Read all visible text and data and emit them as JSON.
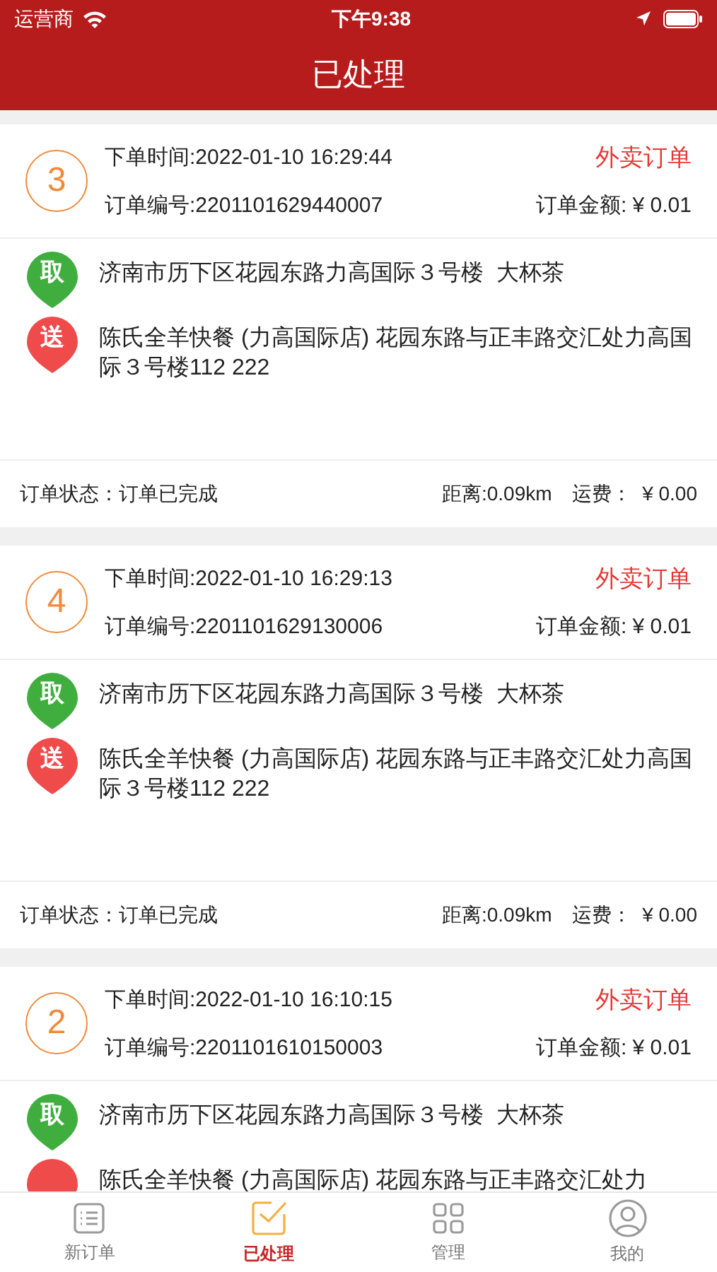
{
  "status_bar": {
    "carrier": "运营商",
    "time": "下午9:38"
  },
  "header": {
    "title": "已处理"
  },
  "orders": [
    {
      "number": "3",
      "time": "下单时间:2022-01-10 16:29:44",
      "type": "外卖订单",
      "order_no": "订单编号:2201101629440007",
      "amount": "订单金额: ¥ 0.01",
      "stops": [
        {
          "kind": "pickup",
          "label": "取",
          "address": "济南市历下区花园东路力高国际３号楼  大杯茶"
        },
        {
          "kind": "delivery",
          "label": "送",
          "address": "陈氏全羊快餐 (力高国际店) 花园东路与正丰路交汇处力高国际３号楼112 222"
        }
      ],
      "status": "订单状态：订单已完成",
      "distance": "距离:0.09km",
      "fee": "运费：  ¥ 0.00"
    },
    {
      "number": "4",
      "time": "下单时间:2022-01-10 16:29:13",
      "type": "外卖订单",
      "order_no": "订单编号:2201101629130006",
      "amount": "订单金额: ¥ 0.01",
      "stops": [
        {
          "kind": "pickup",
          "label": "取",
          "address": "济南市历下区花园东路力高国际３号楼  大杯茶"
        },
        {
          "kind": "delivery",
          "label": "送",
          "address": "陈氏全羊快餐 (力高国际店) 花园东路与正丰路交汇处力高国际３号楼112 222"
        }
      ],
      "status": "订单状态：订单已完成",
      "distance": "距离:0.09km",
      "fee": "运费：  ¥ 0.00"
    },
    {
      "number": "2",
      "time": "下单时间:2022-01-10 16:10:15",
      "type": "外卖订单",
      "order_no": "订单编号:2201101610150003",
      "amount": "订单金额: ¥ 0.01",
      "stops": [
        {
          "kind": "pickup",
          "label": "取",
          "address": "济南市历下区花园东路力高国际３号楼  大杯茶"
        },
        {
          "kind": "delivery",
          "address": "陈氏全羊快餐 (力高国际店) 花园东路与正丰路交汇处力"
        }
      ]
    }
  ],
  "tabs": [
    {
      "kind": "list",
      "label": "新订单",
      "selected": false
    },
    {
      "kind": "done",
      "label": "已处理",
      "selected": true
    },
    {
      "kind": "grid",
      "label": "管理",
      "selected": false
    },
    {
      "kind": "user",
      "label": "我的",
      "selected": false
    }
  ]
}
